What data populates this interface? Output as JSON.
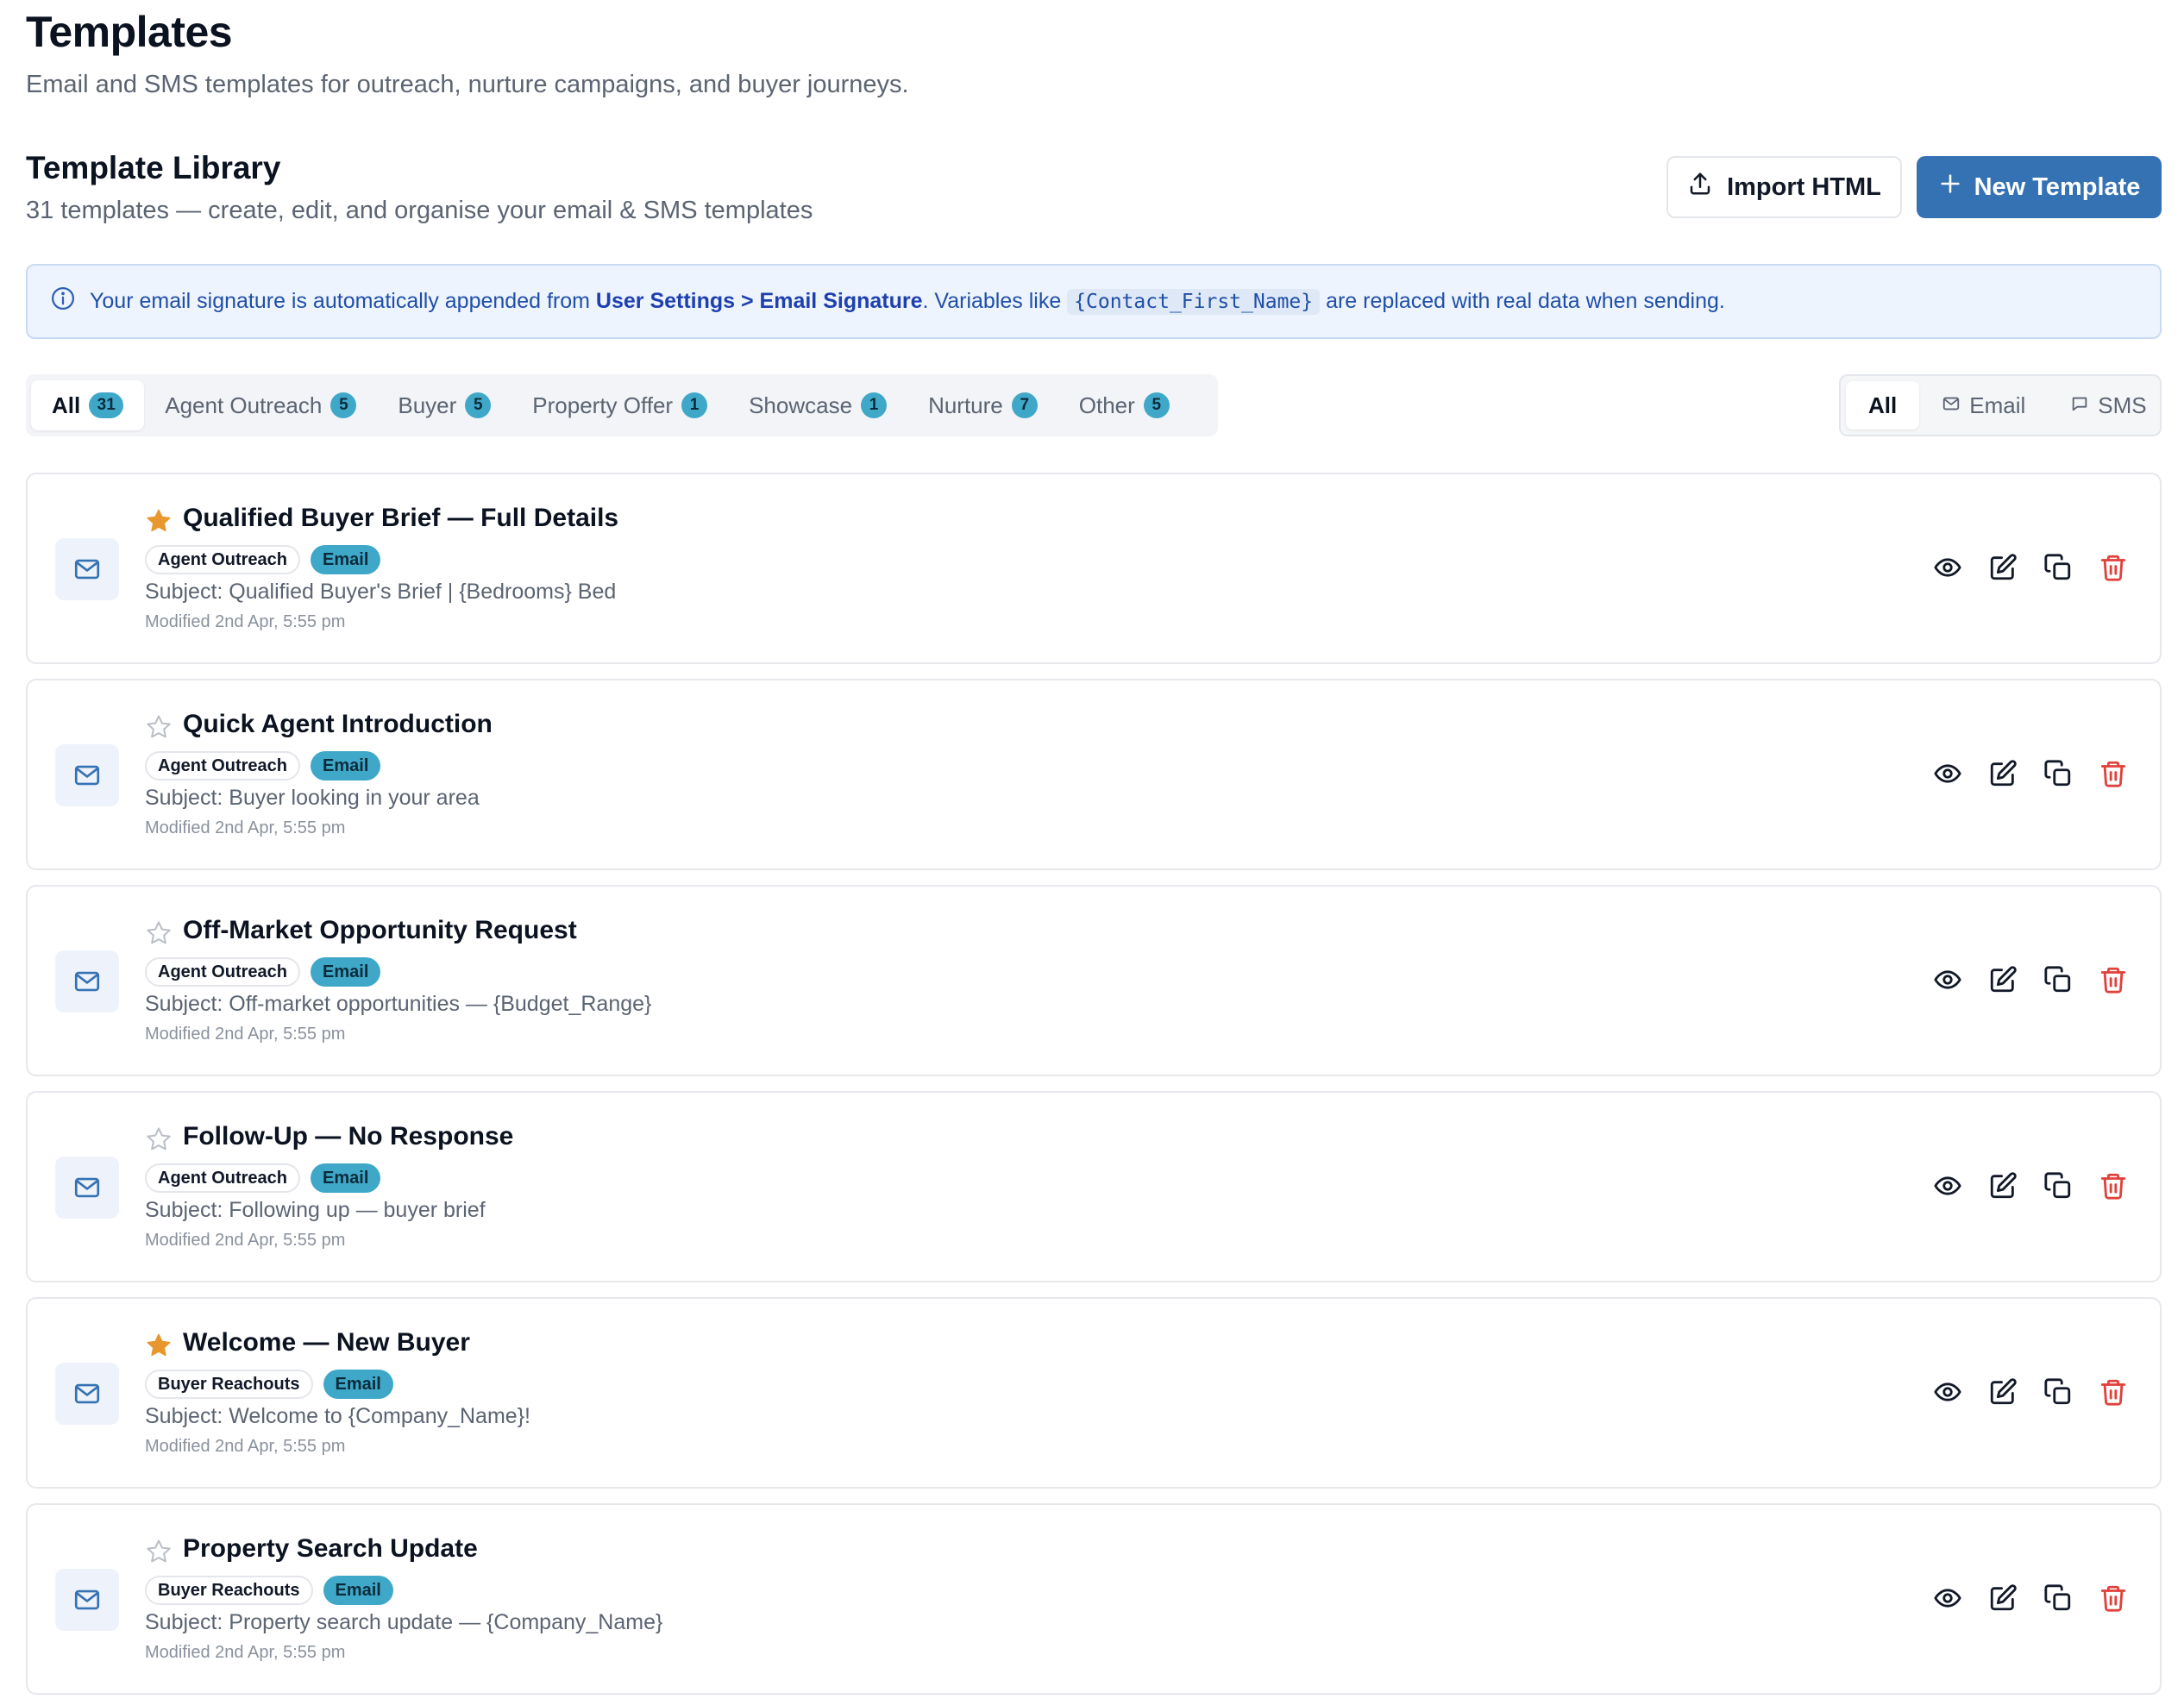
{
  "page": {
    "title": "Templates",
    "subtitle": "Email and SMS templates for outreach, nurture campaigns, and buyer journeys."
  },
  "library": {
    "title": "Template Library",
    "subtitle": "31 templates — create, edit, and organise your email & SMS templates",
    "import_label": "Import HTML",
    "new_label": "New Template"
  },
  "banner": {
    "text_before": "Your email signature is automatically appended from ",
    "link_text": "User Settings > Email Signature",
    "text_middle": ". Variables like ",
    "variable_example": "{Contact_First_Name}",
    "text_after": " are replaced with real data when sending."
  },
  "category_tabs": [
    {
      "label": "All",
      "count": "31",
      "active": true
    },
    {
      "label": "Agent Outreach",
      "count": "5"
    },
    {
      "label": "Buyer",
      "count": "5"
    },
    {
      "label": "Property Offer",
      "count": "1"
    },
    {
      "label": "Showcase",
      "count": "1"
    },
    {
      "label": "Nurture",
      "count": "7"
    },
    {
      "label": "Other",
      "count": "5"
    }
  ],
  "type_tabs": [
    {
      "label": "All",
      "active": true
    },
    {
      "label": "Email",
      "icon": "mail-icon"
    },
    {
      "label": "SMS",
      "icon": "message-icon"
    }
  ],
  "templates": [
    {
      "title": "Qualified Buyer Brief — Full Details",
      "starred": true,
      "category": "Agent Outreach",
      "type": "Email",
      "subject": "Subject: Qualified Buyer's Brief | {Bedrooms} Bed",
      "modified": "Modified 2nd Apr, 5:55 pm"
    },
    {
      "title": "Quick Agent Introduction",
      "starred": false,
      "category": "Agent Outreach",
      "type": "Email",
      "subject": "Subject: Buyer looking in your area",
      "modified": "Modified 2nd Apr, 5:55 pm"
    },
    {
      "title": "Off-Market Opportunity Request",
      "starred": false,
      "category": "Agent Outreach",
      "type": "Email",
      "subject": "Subject: Off-market opportunities — {Budget_Range}",
      "modified": "Modified 2nd Apr, 5:55 pm"
    },
    {
      "title": "Follow-Up — No Response",
      "starred": false,
      "category": "Agent Outreach",
      "type": "Email",
      "subject": "Subject: Following up — buyer brief",
      "modified": "Modified 2nd Apr, 5:55 pm"
    },
    {
      "title": "Welcome — New Buyer",
      "starred": true,
      "category": "Buyer Reachouts",
      "type": "Email",
      "subject": "Subject: Welcome to {Company_Name}!",
      "modified": "Modified 2nd Apr, 5:55 pm"
    },
    {
      "title": "Property Search Update",
      "starred": false,
      "category": "Buyer Reachouts",
      "type": "Email",
      "subject": "Subject: Property search update — {Company_Name}",
      "modified": "Modified 2nd Apr, 5:55 pm"
    }
  ],
  "colors": {
    "primary": "#3572b4",
    "badge": "#3fa8c9",
    "star": "#e8972e",
    "delete": "#e0413b",
    "banner_bg": "#eef4fd"
  }
}
